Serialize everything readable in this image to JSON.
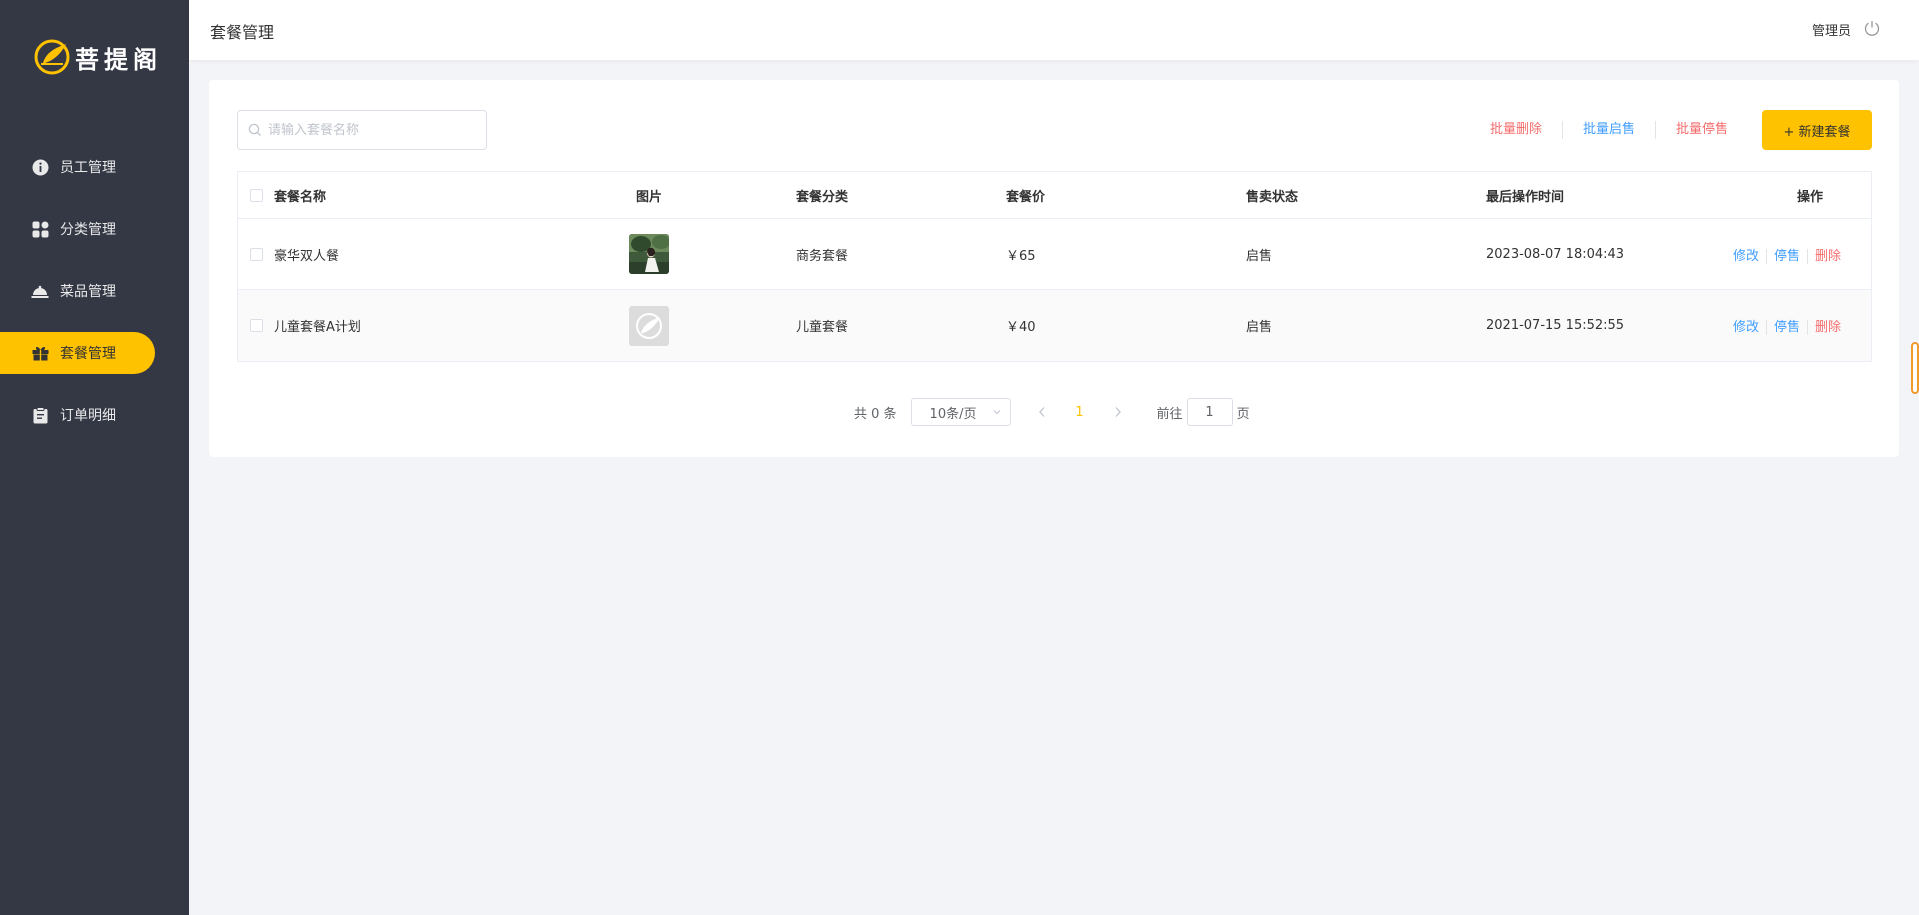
{
  "brand": {
    "name": "菩提阁"
  },
  "sidebar": {
    "items": [
      {
        "label": "员工管理",
        "icon": "info-circle-icon"
      },
      {
        "label": "分类管理",
        "icon": "grid-icon"
      },
      {
        "label": "菜品管理",
        "icon": "dish-cover-icon"
      },
      {
        "label": "套餐管理",
        "icon": "gift-icon"
      },
      {
        "label": "订单明细",
        "icon": "clipboard-icon"
      }
    ],
    "active_index": 3
  },
  "header": {
    "title": "套餐管理",
    "user": "管理员",
    "logout_icon": "power-icon"
  },
  "search": {
    "placeholder": "请输入套餐名称",
    "value": ""
  },
  "toolbar": {
    "batch_delete": "批量删除",
    "batch_enable": "批量启售",
    "batch_disable": "批量停售",
    "add": "+ 新建套餐"
  },
  "table": {
    "columns": [
      "套餐名称",
      "图片",
      "套餐分类",
      "套餐价",
      "售卖状态",
      "最后操作时间",
      "操作"
    ],
    "rows": [
      {
        "name": "豪华双人餐",
        "category": "商务套餐",
        "price": "￥65",
        "status": "启售",
        "updated": "2023-08-07 18:04:43",
        "ops": [
          "修改",
          "停售",
          "删除"
        ]
      },
      {
        "name": "儿童套餐A计划",
        "category": "儿童套餐",
        "price": "￥40",
        "status": "启售",
        "updated": "2021-07-15 15:52:55",
        "ops": [
          "修改",
          "停售",
          "删除"
        ]
      }
    ]
  },
  "pagination": {
    "total": "共 0 条",
    "page_size": "10条/页",
    "current": "1",
    "goto_prefix": "前往",
    "goto_value": "1",
    "goto_suffix": "页"
  },
  "colors": {
    "sidebar": "#343744",
    "accent": "#ffc200",
    "danger": "#f56c6c",
    "link": "#419eff"
  }
}
